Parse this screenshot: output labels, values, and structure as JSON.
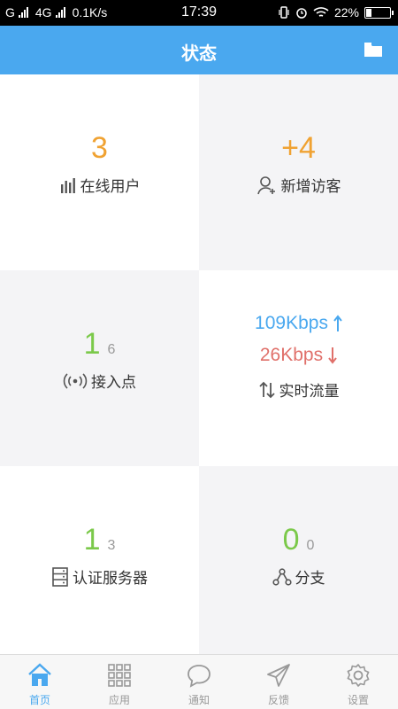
{
  "status_bar": {
    "carrier1": "G",
    "carrier2": "4G",
    "speed": "0.1K/s",
    "time": "17:39",
    "battery": "22%",
    "battery_level": 0.22
  },
  "header": {
    "title": "状态"
  },
  "tiles": {
    "online_users": {
      "value": "3",
      "label": "在线用户"
    },
    "new_visitors": {
      "value": "+4",
      "label": "新增访客"
    },
    "access_points": {
      "value": "1",
      "sub": "6",
      "label": "接入点"
    },
    "realtime_traffic": {
      "up": "109Kbps",
      "down": "26Kbps",
      "label": "实时流量"
    },
    "auth_servers": {
      "value": "1",
      "sub": "3",
      "label": "认证服务器"
    },
    "branches": {
      "value": "0",
      "sub": "0",
      "label": "分支"
    }
  },
  "tabbar": {
    "home": "首页",
    "apps": "应用",
    "notify": "通知",
    "feedback": "反馈",
    "settings": "设置"
  },
  "colors": {
    "accent": "#4aa8ef",
    "orange": "#f0a232",
    "green": "#7bc94a",
    "red": "#e0706a"
  }
}
